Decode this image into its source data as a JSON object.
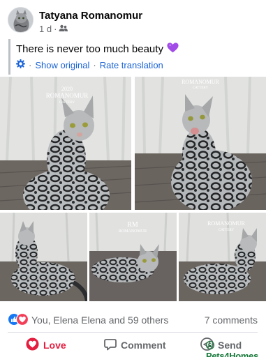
{
  "post": {
    "author": "Tatyana Romanomur",
    "time": "1 d",
    "audience_icon": "friends-icon",
    "text": "There is never too much beauty",
    "emoji": "purple-heart",
    "show_original": "Show original",
    "rate_translation": "Rate translation",
    "separator": "·"
  },
  "photos": {
    "watermark_year": "2020",
    "watermark_name": "ROMANOMUR",
    "watermark_sub": "CATTERY"
  },
  "reactions": {
    "text": "You, Elena Elena and 59 others",
    "comments": "7 comments"
  },
  "actions": {
    "love": "Love",
    "comment": "Comment",
    "send": "Send"
  },
  "overlay": {
    "watermark": "Pets4Homes"
  },
  "colors": {
    "link": "#1b63d6",
    "love": "#e41e3f",
    "like_blue": "#1877f2",
    "muted": "#65676b"
  }
}
